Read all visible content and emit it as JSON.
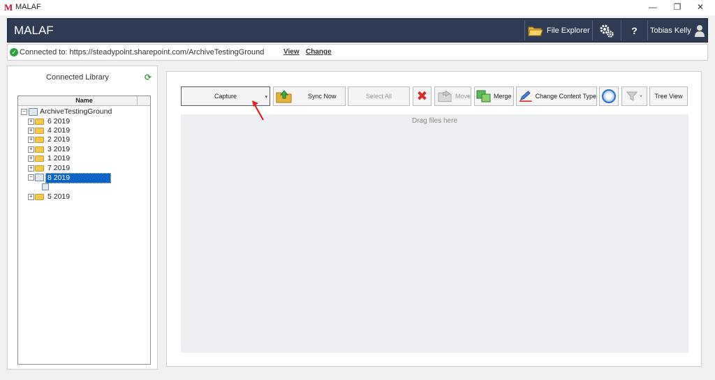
{
  "window": {
    "logo": "M",
    "title": "MALAF",
    "controls": {
      "minimize": "—",
      "maximize": "❐",
      "close": "✕"
    }
  },
  "header": {
    "app_name": "MALAF",
    "file_explorer": "File Explorer",
    "help": "?",
    "user_name": "Tobias Kelly"
  },
  "status": {
    "connected_text": "Connected to: https://steadypoint.sharepoint.com/ArchiveTestingGround",
    "view_link": "View",
    "change_link": "Change"
  },
  "library": {
    "title": "Connected Library",
    "column_header": "Name",
    "root": "ArchiveTestingGround",
    "items": [
      {
        "label": "6  2019",
        "expander": "+"
      },
      {
        "label": "4  2019",
        "expander": "+"
      },
      {
        "label": "2  2019",
        "expander": "+"
      },
      {
        "label": "3  2019",
        "expander": "+"
      },
      {
        "label": "1  2019",
        "expander": "+"
      },
      {
        "label": "7  2019",
        "expander": "+"
      },
      {
        "label": "8  2019",
        "expander": "−",
        "selected": true
      },
      {
        "label": "5  2019",
        "expander": "+"
      }
    ],
    "root_expander": "−"
  },
  "toolbar": {
    "capture": "Capture",
    "capture_caret": "▾",
    "sync_now": "Sync Now",
    "select_all": "Select All",
    "move": "Move",
    "merge": "Merge",
    "change_content_type": "Change Content Type",
    "filter_caret": "▾",
    "tree_view": "Tree View"
  },
  "drop_area": {
    "text": "Drag files here"
  },
  "colors": {
    "header_bg": "#2e3b52",
    "selection": "#0a64c8",
    "connected": "#2ea043",
    "delete": "#d32f2f",
    "pointer_arrow": "#e02020"
  },
  "icons": {
    "folder": "folder-icon",
    "file_explorer": "folder-open-icon",
    "settings": "gears-icon",
    "user": "user-icon",
    "refresh": "refresh-icon",
    "sync": "sync-folder-icon",
    "delete": "x-icon",
    "move": "move-folder-icon",
    "merge": "merge-icon",
    "change_type": "pencil-icon",
    "filter": "funnel-icon"
  }
}
